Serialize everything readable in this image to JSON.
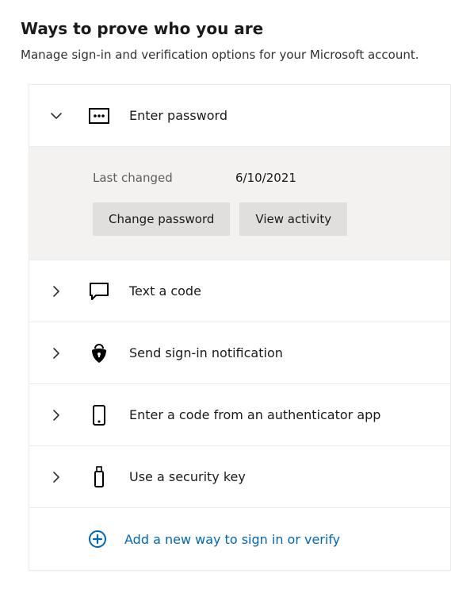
{
  "page": {
    "title": "Ways to prove who you are",
    "subtitle": "Manage sign-in and verification options for your Microsoft account."
  },
  "sections": {
    "password": {
      "label": "Enter password",
      "detail": {
        "last_changed_label": "Last changed",
        "last_changed_value": "6/10/2021",
        "change_password_label": "Change password",
        "view_activity_label": "View activity"
      }
    },
    "text_code": {
      "label": "Text a code"
    },
    "notification": {
      "label": "Send sign-in notification"
    },
    "auth_app": {
      "label": "Enter a code from an authenticator app"
    },
    "security_key": {
      "label": "Use a security key"
    }
  },
  "add_new": {
    "label": "Add a new way to sign in or verify"
  },
  "colors": {
    "link": "#0067b8"
  }
}
